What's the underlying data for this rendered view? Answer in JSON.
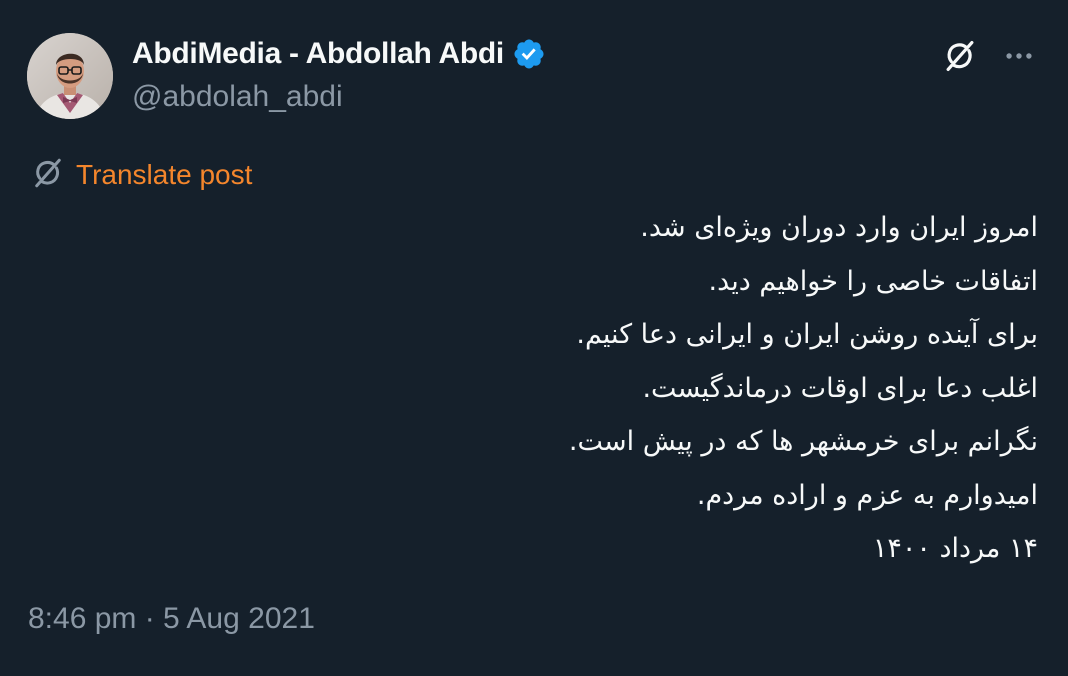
{
  "author": {
    "display_name": "AbdiMedia - Abdollah Abdi",
    "handle": "@abdolah_abdi",
    "verified": true
  },
  "icons": {
    "avatar": "profile-photo",
    "verified": "verified-badge-icon",
    "grok": "grok-icon",
    "more": "more-horizontal-icon",
    "translate": "translate-icon"
  },
  "colors": {
    "background": "#15202b",
    "text_primary": "#f7f9f9",
    "text_secondary": "#8b98a5",
    "verified_blue": "#1d9bf0",
    "translate_link": "#f4862c"
  },
  "translate": {
    "label": "Translate post"
  },
  "post": {
    "lines": [
      "امروز ایران وارد دوران ویژه‌ای شد.",
      "اتفاقات خاصی را خواهیم دید.",
      "برای آینده روشن ایران و ایرانی دعا کنیم.",
      "اغلب دعا برای اوقات درماندگیست.",
      "نگرانم برای خرمشهر ها که در پیش است.",
      "امیدوارم به عزم و اراده مردم.",
      "۱۴ مرداد ۱۴۰۰"
    ]
  },
  "timestamp": {
    "text": "8:46 pm · 5 Aug 2021"
  }
}
